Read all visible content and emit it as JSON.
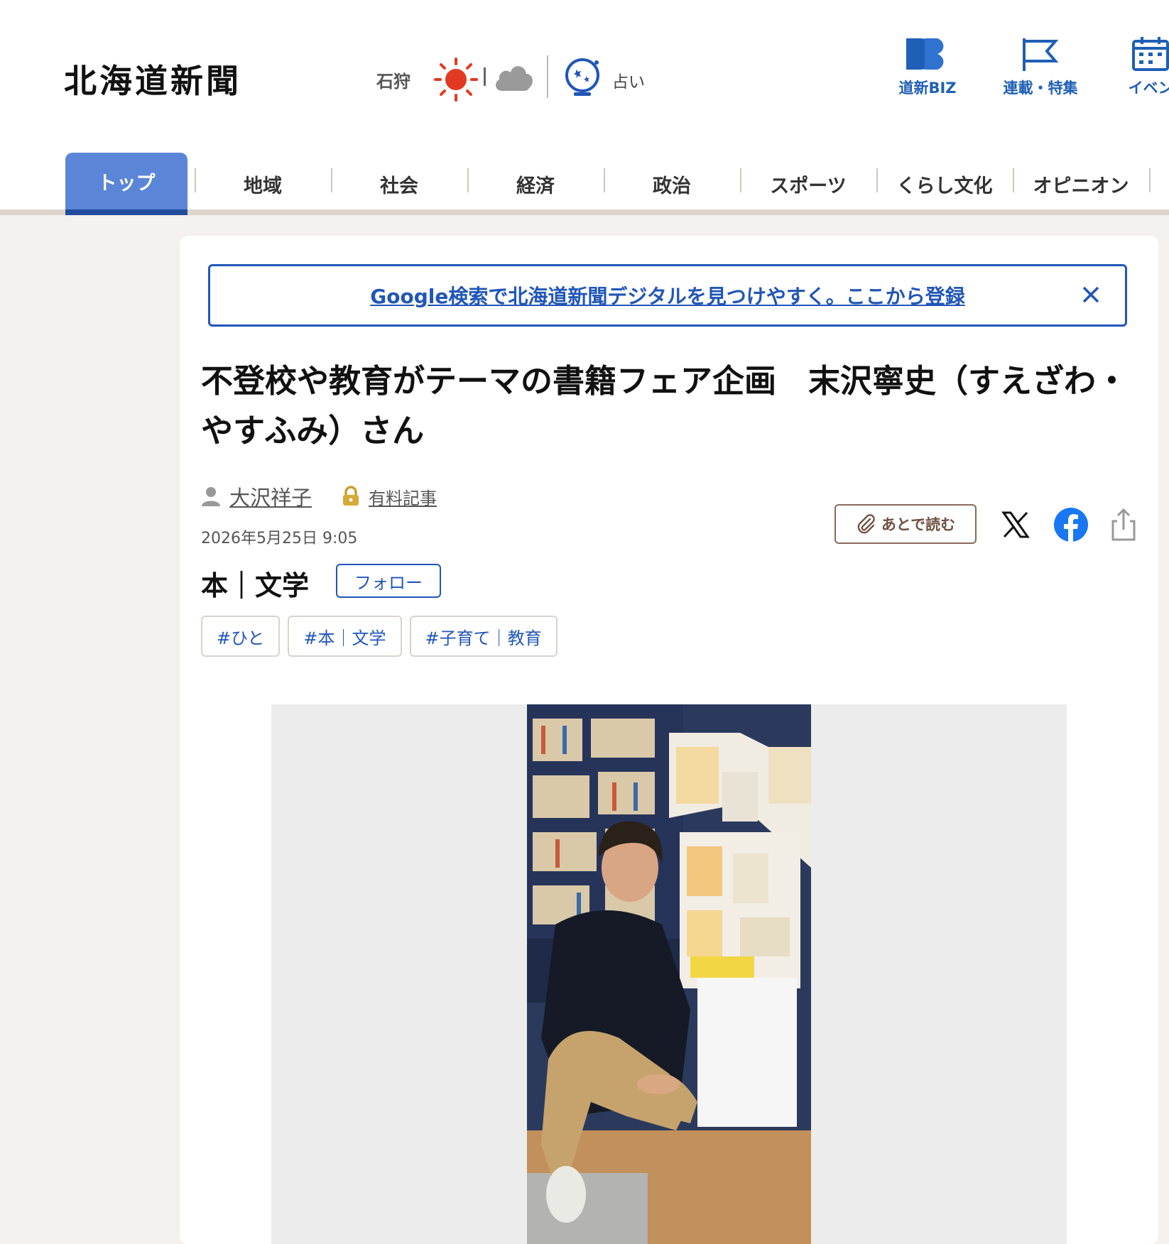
{
  "header": {
    "logo": "北海道新聞",
    "weather": {
      "city": "石狩",
      "icons": [
        "sun-icon",
        "cloud-icon"
      ]
    },
    "fortune_label": "占い",
    "links": [
      {
        "label": "道新BIZ",
        "icon": "dd-biz-icon"
      },
      {
        "label": "連載・特集",
        "icon": "flag-icon"
      },
      {
        "label": "イベン",
        "icon": "calendar-icon"
      }
    ]
  },
  "nav": {
    "tabs": [
      {
        "label": "トップ",
        "active": true
      },
      {
        "label": "地域"
      },
      {
        "label": "社会"
      },
      {
        "label": "経済"
      },
      {
        "label": "政治"
      },
      {
        "label": "スポーツ"
      },
      {
        "label": "くらし文化"
      },
      {
        "label": "オピニオン"
      }
    ]
  },
  "banner": {
    "text": "Google検索で北海道新聞デジタルを見つけやすく。ここから登録"
  },
  "article": {
    "title": "不登校や教育がテーマの書籍フェア企画　末沢寧史（すえざわ・やすふみ）さん",
    "author": "大沢祥子",
    "paid_label": "有料記事",
    "date": "2026年5月25日 9:05",
    "read_later": "あとで読む",
    "category": "本｜文学",
    "follow_label": "フォロー",
    "tags": [
      "#ひと",
      "#本｜文学",
      "#子育て｜教育"
    ],
    "share_icons": [
      "x-icon",
      "facebook-icon",
      "share-icon"
    ]
  },
  "colors": {
    "brand_blue": "#2156b8",
    "nav_active": "#5b86d8",
    "page_bg": "#f4f1ee"
  }
}
